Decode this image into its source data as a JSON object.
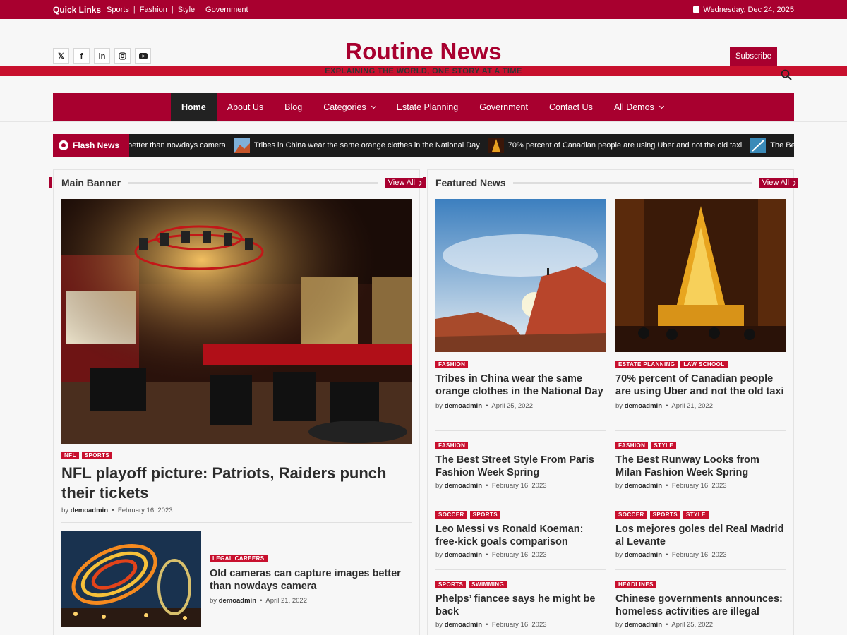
{
  "topbar": {
    "quick_links_title": "Quick Links",
    "links": [
      "Sports",
      "Fashion",
      "Style",
      "Government"
    ],
    "date": "Wednesday, Dec 24, 2025"
  },
  "header": {
    "site_title": "Routine News",
    "tagline": "Explaining the World, One Story at a Time",
    "subscribe_label": "Subscribe",
    "social_icons": [
      "x-icon",
      "facebook-icon",
      "linkedin-icon",
      "instagram-icon",
      "youtube-icon"
    ]
  },
  "nav": {
    "items": [
      "Home",
      "About Us",
      "Blog",
      "Categories",
      "Estate Planning",
      "Government",
      "Contact Us",
      "All Demos"
    ]
  },
  "flash": {
    "label": "Flash News",
    "items": [
      "better than nowdays camera",
      "Tribes in China wear the same orange clothes in the National Day",
      "70% percent of Canadian people are using Uber and not the old taxi",
      "The Be"
    ]
  },
  "main_banner": {
    "section_title": "Main Banner",
    "view_all": "View All",
    "featured": {
      "tags": [
        "NFL",
        "SPORTS"
      ],
      "title": "NFL playoff picture: Patriots, Raiders punch their tickets",
      "by": "by",
      "author": "demoadmin",
      "date": "February 16, 2023"
    },
    "secondary": {
      "tags": [
        "LEGAL CAREERS"
      ],
      "title": "Old cameras can capture images better than nowdays camera",
      "by": "by",
      "author": "demoadmin",
      "date": "April 21, 2022"
    }
  },
  "featured_news": {
    "section_title": "Featured News",
    "view_all": "View All",
    "cards": [
      {
        "tags": [
          "FASHION"
        ],
        "title": "Tribes in China wear the same orange clothes in the National Day",
        "by": "by",
        "author": "demoadmin",
        "date": "April 25, 2022"
      },
      {
        "tags": [
          "ESTATE PLANNING",
          "LAW SCHOOL"
        ],
        "title": "70% percent of Canadian people are using Uber and not the old taxi",
        "by": "by",
        "author": "demoadmin",
        "date": "April 21, 2022"
      }
    ],
    "list": [
      {
        "tags": [
          "FASHION"
        ],
        "title": "The Best Street Style From Paris Fashion Week Spring",
        "by": "by",
        "author": "demoadmin",
        "date": "February 16, 2023"
      },
      {
        "tags": [
          "FASHION",
          "STYLE"
        ],
        "title": "The Best Runway Looks from Milan Fashion Week Spring",
        "by": "by",
        "author": "demoadmin",
        "date": "February 16, 2023"
      },
      {
        "tags": [
          "SOCCER",
          "SPORTS"
        ],
        "title": "Leo Messi vs Ronald Koeman: free-kick goals comparison",
        "by": "by",
        "author": "demoadmin",
        "date": "February 16, 2023"
      },
      {
        "tags": [
          "SOCCER",
          "SPORTS",
          "STYLE"
        ],
        "title": "Los mejores goles del Real Madrid al Levante",
        "by": "by",
        "author": "demoadmin",
        "date": "February 16, 2023"
      },
      {
        "tags": [
          "SPORTS",
          "SWIMMING"
        ],
        "title": "Phelps’ fiancee says he might be back",
        "by": "by",
        "author": "demoadmin",
        "date": "February 16, 2023"
      },
      {
        "tags": [
          "HEADLINES"
        ],
        "title": "Chinese governments announces: homeless activities are illegal",
        "by": "by",
        "author": "demoadmin",
        "date": "April 25, 2022"
      }
    ]
  },
  "colors": {
    "brand": "#a8002f",
    "dark": "#1c1c1c",
    "tag": "#c8102e"
  }
}
